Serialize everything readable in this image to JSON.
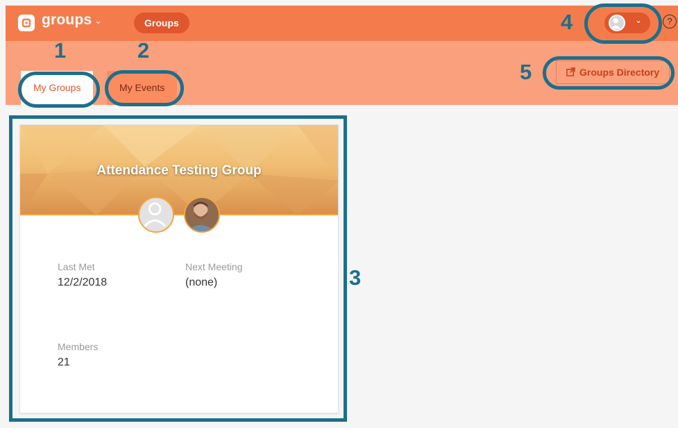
{
  "header": {
    "brand": "groups",
    "brand_caret": "⌄",
    "groups_pill": "Groups",
    "avatar_caret": "⌄",
    "help": "?"
  },
  "tabs": [
    {
      "label": "My Groups"
    },
    {
      "label": "My Events"
    }
  ],
  "directory_button": {
    "label": "Groups Directory"
  },
  "group_card": {
    "title": "Attendance Testing Group",
    "last_met_label": "Last Met",
    "last_met_value": "12/2/2018",
    "next_meeting_label": "Next Meeting",
    "next_meeting_value": "(none)",
    "members_label": "Members",
    "members_value": "21"
  },
  "annotations": [
    "1",
    "2",
    "3",
    "4",
    "5"
  ],
  "colors": {
    "header": "#f47c4c",
    "subheader": "#fba07c",
    "accent": "#e0562e",
    "annotation": "#1d6f8c"
  }
}
